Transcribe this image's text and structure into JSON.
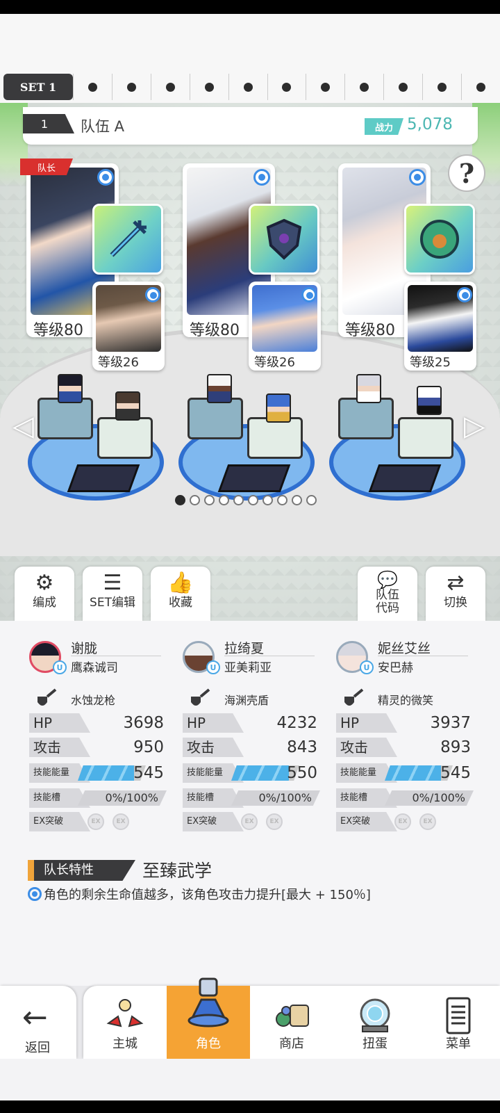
{
  "set_tabs": {
    "active_label": "SET 1",
    "other_count": 11
  },
  "team": {
    "number": "1",
    "name": "队伍 A",
    "power_label": "战力",
    "power_value": "5,078"
  },
  "help_label": "?",
  "leader_tag": "队长",
  "cards": [
    {
      "level": "等级80",
      "sub_level": "等级26"
    },
    {
      "level": "等级80",
      "sub_level": "等级26"
    },
    {
      "level": "等级80",
      "sub_level": "等级25"
    }
  ],
  "nav_arrows": {
    "left": "◁",
    "right": "▷"
  },
  "page_dots": {
    "total": 10,
    "active": 1
  },
  "actions": [
    {
      "label": "编成",
      "icon": "person-gear-icon"
    },
    {
      "label": "SET编辑",
      "icon": "list-icon"
    },
    {
      "label": "收藏",
      "icon": "thumb-star-icon"
    },
    {
      "label": "队伍\n代码",
      "icon": "chat-bubble-icon"
    },
    {
      "label": "切换",
      "icon": "swap-icon"
    }
  ],
  "members": [
    {
      "name": "谢胧",
      "sub": "鹰森诚司",
      "weapon": "水蚀龙枪",
      "hp_label": "HP",
      "hp": "3698",
      "atk_label": "攻击",
      "atk": "950",
      "energy_label": "技能能量",
      "energy": "545",
      "energy_fill": 0.83,
      "slot_label": "技能槽",
      "slot": "0%/100%",
      "ex_label": "EX突破",
      "ex": "EX"
    },
    {
      "name": "拉绮夏",
      "sub": "亚美莉亚",
      "weapon": "海渊壳盾",
      "hp_label": "HP",
      "hp": "4232",
      "atk_label": "攻击",
      "atk": "843",
      "energy_label": "技能能量",
      "energy": "550",
      "energy_fill": 0.85,
      "slot_label": "技能槽",
      "slot": "0%/100%",
      "ex_label": "EX突破",
      "ex": "EX"
    },
    {
      "name": "妮丝艾丝",
      "sub": "安巴赫",
      "weapon": "精灵的微笑",
      "hp_label": "HP",
      "hp": "3937",
      "atk_label": "攻击",
      "atk": "893",
      "energy_label": "技能能量",
      "energy": "545",
      "energy_fill": 0.83,
      "slot_label": "技能槽",
      "slot": "0%/100%",
      "ex_label": "EX突破",
      "ex": "EX"
    }
  ],
  "leader_trait": {
    "label": "队长特性",
    "title": "至臻武学",
    "desc": "角色的剩余生命值越多，该角色攻击力提升[最大 + 150％]"
  },
  "bottom_nav": {
    "back": "返回",
    "items": [
      {
        "label": "主城",
        "icon": "castle-icon",
        "active": false
      },
      {
        "label": "角色",
        "icon": "character-icon",
        "active": true
      },
      {
        "label": "商店",
        "icon": "shop-icon",
        "active": false
      },
      {
        "label": "扭蛋",
        "icon": "gacha-icon",
        "active": false
      },
      {
        "label": "菜单",
        "icon": "menu-icon",
        "active": false
      }
    ]
  },
  "colors": {
    "accent": "#f5a334",
    "leader_red": "#d9302e",
    "power_teal": "#5ecbc6",
    "badge_blue": "#3c8de6"
  }
}
